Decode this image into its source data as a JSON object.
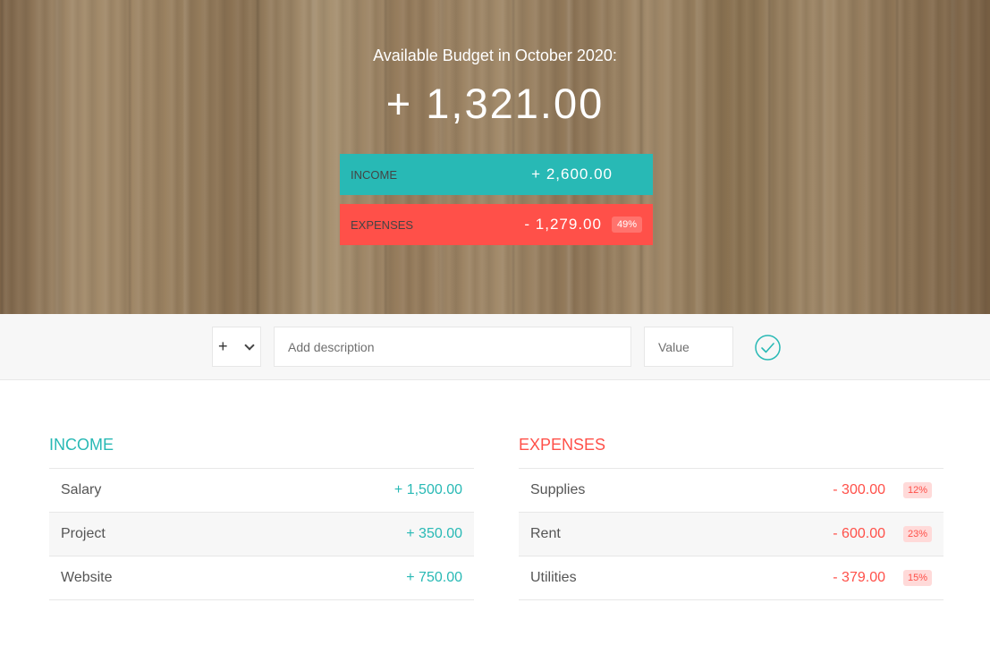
{
  "header": {
    "budget_title": "Available Budget in October 2020:",
    "budget_value": "+ 1,321.00",
    "income": {
      "label": "Income",
      "value": "+ 2,600.00"
    },
    "expenses": {
      "label": "Expenses",
      "value": "- 1,279.00",
      "percentage": "49%"
    }
  },
  "add": {
    "type_value": "+",
    "description_placeholder": "Add description",
    "value_placeholder": "Value"
  },
  "income_list": {
    "title": "Income",
    "items": [
      {
        "description": "Salary",
        "value": "+ 1,500.00"
      },
      {
        "description": "Project",
        "value": "+ 350.00"
      },
      {
        "description": "Website",
        "value": "+ 750.00"
      }
    ]
  },
  "expenses_list": {
    "title": "Expenses",
    "items": [
      {
        "description": "Supplies",
        "value": "- 300.00",
        "percentage": "12%"
      },
      {
        "description": "Rent",
        "value": "- 600.00",
        "percentage": "23%"
      },
      {
        "description": "Utilities",
        "value": "- 379.00",
        "percentage": "15%"
      }
    ]
  },
  "colors": {
    "income": "#28b9b5",
    "expenses": "#ff5049",
    "wood": "#8f7658"
  },
  "icons": {
    "add_button": "checkmark-circle-icon",
    "type_select": "chevron-down-icon"
  }
}
